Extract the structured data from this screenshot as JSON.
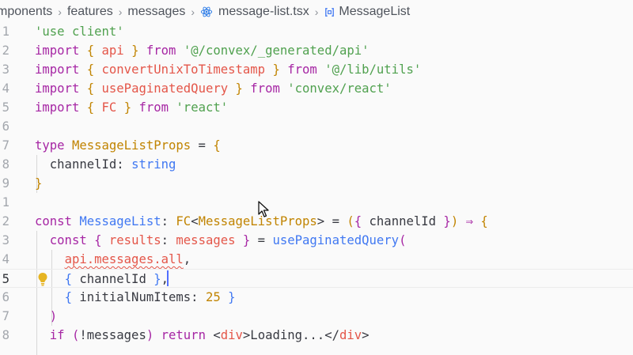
{
  "breadcrumb": {
    "items": [
      "mponents",
      "features",
      "messages",
      "message-list.tsx",
      "MessageList"
    ],
    "separator": "›"
  },
  "code": {
    "line_numbers": [
      "1",
      "2",
      "3",
      "4",
      "5",
      "6",
      "7",
      "8",
      "9",
      "1",
      "2",
      "3",
      "4",
      "5",
      "6",
      "7",
      "8"
    ],
    "lines": [
      [
        [
          "str",
          "'use client'"
        ]
      ],
      [
        [
          "kw",
          "import"
        ],
        [
          "plain",
          " "
        ],
        [
          "brk1",
          "{"
        ],
        [
          "plain",
          " "
        ],
        [
          "var",
          "api"
        ],
        [
          "plain",
          " "
        ],
        [
          "brk1",
          "}"
        ],
        [
          "plain",
          " "
        ],
        [
          "kw",
          "from"
        ],
        [
          "plain",
          " "
        ],
        [
          "str",
          "'@/convex/_generated/api'"
        ]
      ],
      [
        [
          "kw",
          "import"
        ],
        [
          "plain",
          " "
        ],
        [
          "brk1",
          "{"
        ],
        [
          "plain",
          " "
        ],
        [
          "var",
          "convertUnixToTimestamp"
        ],
        [
          "plain",
          " "
        ],
        [
          "brk1",
          "}"
        ],
        [
          "plain",
          " "
        ],
        [
          "kw",
          "from"
        ],
        [
          "plain",
          " "
        ],
        [
          "str",
          "'@/lib/utils'"
        ]
      ],
      [
        [
          "kw",
          "import"
        ],
        [
          "plain",
          " "
        ],
        [
          "brk1",
          "{"
        ],
        [
          "plain",
          " "
        ],
        [
          "var",
          "usePaginatedQuery"
        ],
        [
          "plain",
          " "
        ],
        [
          "brk1",
          "}"
        ],
        [
          "plain",
          " "
        ],
        [
          "kw",
          "from"
        ],
        [
          "plain",
          " "
        ],
        [
          "str",
          "'convex/react'"
        ]
      ],
      [
        [
          "kw",
          "import"
        ],
        [
          "plain",
          " "
        ],
        [
          "brk1",
          "{"
        ],
        [
          "plain",
          " "
        ],
        [
          "var",
          "FC"
        ],
        [
          "plain",
          " "
        ],
        [
          "brk1",
          "}"
        ],
        [
          "plain",
          " "
        ],
        [
          "kw",
          "from"
        ],
        [
          "plain",
          " "
        ],
        [
          "str",
          "'react'"
        ]
      ],
      [],
      [
        [
          "kw",
          "type"
        ],
        [
          "plain",
          " "
        ],
        [
          "cls",
          "MessageListProps"
        ],
        [
          "plain",
          " = "
        ],
        [
          "brk1",
          "{"
        ]
      ],
      [
        [
          "plain",
          "  "
        ],
        [
          "plain",
          "channelId"
        ],
        [
          "plain",
          ": "
        ],
        [
          "fn",
          "string"
        ]
      ],
      [
        [
          "brk1",
          "}"
        ]
      ],
      [],
      [
        [
          "kw",
          "const"
        ],
        [
          "plain",
          " "
        ],
        [
          "fn",
          "MessageList"
        ],
        [
          "plain",
          ": "
        ],
        [
          "cls",
          "FC"
        ],
        [
          "plain",
          "<"
        ],
        [
          "cls",
          "MessageListProps"
        ],
        [
          "plain",
          "> = "
        ],
        [
          "brk1",
          "("
        ],
        [
          "brk2",
          "{"
        ],
        [
          "plain",
          " channelId "
        ],
        [
          "brk2",
          "}"
        ],
        [
          "brk1",
          ")"
        ],
        [
          "plain",
          " "
        ],
        [
          "kw",
          "⇒"
        ],
        [
          "plain",
          " "
        ],
        [
          "brk1",
          "{"
        ]
      ],
      [
        [
          "plain",
          "  "
        ],
        [
          "kw",
          "const"
        ],
        [
          "plain",
          " "
        ],
        [
          "brk2",
          "{"
        ],
        [
          "plain",
          " "
        ],
        [
          "var",
          "results"
        ],
        [
          "plain",
          ": "
        ],
        [
          "var",
          "messages"
        ],
        [
          "plain",
          " "
        ],
        [
          "brk2",
          "}"
        ],
        [
          "plain",
          " = "
        ],
        [
          "fn",
          "usePaginatedQuery"
        ],
        [
          "brk2",
          "("
        ]
      ],
      [
        [
          "plain",
          "    "
        ],
        [
          "sq",
          "api.messages.all"
        ],
        [
          "plain",
          ","
        ]
      ],
      [
        [
          "plain",
          "    "
        ],
        [
          "brk3",
          "{"
        ],
        [
          "plain",
          " channelId "
        ],
        [
          "brk3",
          "}"
        ],
        [
          "plain",
          ","
        ]
      ],
      [
        [
          "plain",
          "    "
        ],
        [
          "brk3",
          "{"
        ],
        [
          "plain",
          " initialNumItems: "
        ],
        [
          "cls",
          "25"
        ],
        [
          "plain",
          " "
        ],
        [
          "brk3",
          "}"
        ]
      ],
      [
        [
          "plain",
          "  "
        ],
        [
          "brk2",
          ")"
        ]
      ],
      [
        [
          "plain",
          "  "
        ],
        [
          "kw",
          "if"
        ],
        [
          "plain",
          " "
        ],
        [
          "brk2",
          "("
        ],
        [
          "plain",
          "!messages"
        ],
        [
          "brk2",
          ")"
        ],
        [
          "plain",
          " "
        ],
        [
          "kw",
          "return"
        ],
        [
          "plain",
          " <"
        ],
        [
          "tag",
          "div"
        ],
        [
          "plain",
          ">Loading...</"
        ],
        [
          "tag",
          "div"
        ],
        [
          "plain",
          ">"
        ]
      ]
    ],
    "active_line_index": 13
  },
  "icons": {
    "file_icon": "react-icon",
    "symbol_icon": "symbol-class-icon",
    "lightbulb": "lightbulb-icon",
    "mouse_pointer": "mouse-pointer-icon"
  },
  "colors": {
    "background": "#fafafa",
    "keyword": "#a626a4",
    "string": "#50a14f",
    "function": "#4078f2",
    "type": "#c18401",
    "variable": "#e45649",
    "cursor": "#526fff",
    "lightbulb": "#e6b422"
  }
}
